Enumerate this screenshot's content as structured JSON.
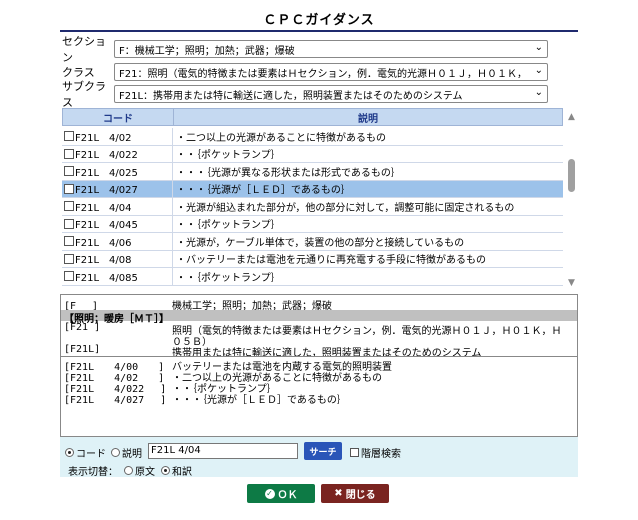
{
  "title": "ＣＰＣガイダンス",
  "section": {
    "label": "セクション",
    "value": "F：機械工学；照明；加熱；武器；爆破"
  },
  "class": {
    "label": "クラス",
    "value": "F21：照明（電気的特徴または要素はＨセクション，例．電気的光源Ｈ０１Ｊ，Ｈ０１Ｋ，Ｈ０..."
  },
  "subclass": {
    "label": "サブクラス",
    "value": "F21L：携帯用または特に輸送に適した，照明装置またはそのためのシステム"
  },
  "table": {
    "col_code": "コード",
    "col_desc": "説明",
    "rows": [
      {
        "code": "F21L　4/02",
        "desc": "・二つ以上の光源があることに特徴があるもの"
      },
      {
        "code": "F21L　4/022",
        "desc": "・・｛ポケットランプ｝"
      },
      {
        "code": "F21L　4/025",
        "desc": "・・・｛光源が異なる形状または形式であるもの｝"
      },
      {
        "code": "F21L　4/027",
        "desc": "・・・｛光源が［ＬＥＤ］であるもの｝"
      },
      {
        "code": "F21L　4/04",
        "desc": "・光源が組込まれた部分が，他の部分に対して，調整可能に固定されるもの"
      },
      {
        "code": "F21L　4/045",
        "desc": "・・｛ポケットランプ｝"
      },
      {
        "code": "F21L　4/06",
        "desc": "・光源が，ケーブル単体で，装置の他の部分と接続しているもの"
      },
      {
        "code": "F21L　4/08",
        "desc": "・バッテリーまたは電池を元通りに再充電する手段に特徴があるもの"
      },
      {
        "code": "F21L　4/085",
        "desc": "・・｛ポケットランプ｝"
      }
    ],
    "selected_index": 3
  },
  "detail": {
    "line1_code": "[F　 ]",
    "line1_text": "機械工学；照明；加熱；武器；爆破",
    "band1": "【照明；暖房［ＭＴ］】",
    "line2_code": "[F21 ]",
    "line2_text": "照明（電気的特徴または要素はＨセクション，例．電気的光源Ｈ０１Ｊ，Ｈ０１Ｋ，Ｈ",
    "line2_cont": "０５Ｂ）",
    "line3_code": "[F21L]",
    "line3_text": "携帯用または特に輸送に適した，照明装置またはそのためのシステム",
    "items": [
      {
        "code": "[F21L　　4/00　　]",
        "text": "バッテリーまたは電池を内蔵する電気的照明装置"
      },
      {
        "code": "[F21L　　4/02　　]",
        "text": "・二つ以上の光源があることに特徴があるもの"
      },
      {
        "code": "[F21L　　4/022 　]",
        "text": "・・｛ポケットランプ｝"
      },
      {
        "code": "[F21L　　4/027 　]",
        "text": "・・・｛光源が［ＬＥＤ］であるもの｝"
      }
    ]
  },
  "search": {
    "radio_code": "コード",
    "radio_desc": "説明",
    "input_value": "F21L 4/04",
    "search_button": "サーチ",
    "hier_label": "階層検索",
    "display_label": "表示切替：",
    "opt_original": "原文",
    "opt_translated": "和訳"
  },
  "buttons": {
    "ok": "ＯＫ",
    "close": "閉じる"
  }
}
